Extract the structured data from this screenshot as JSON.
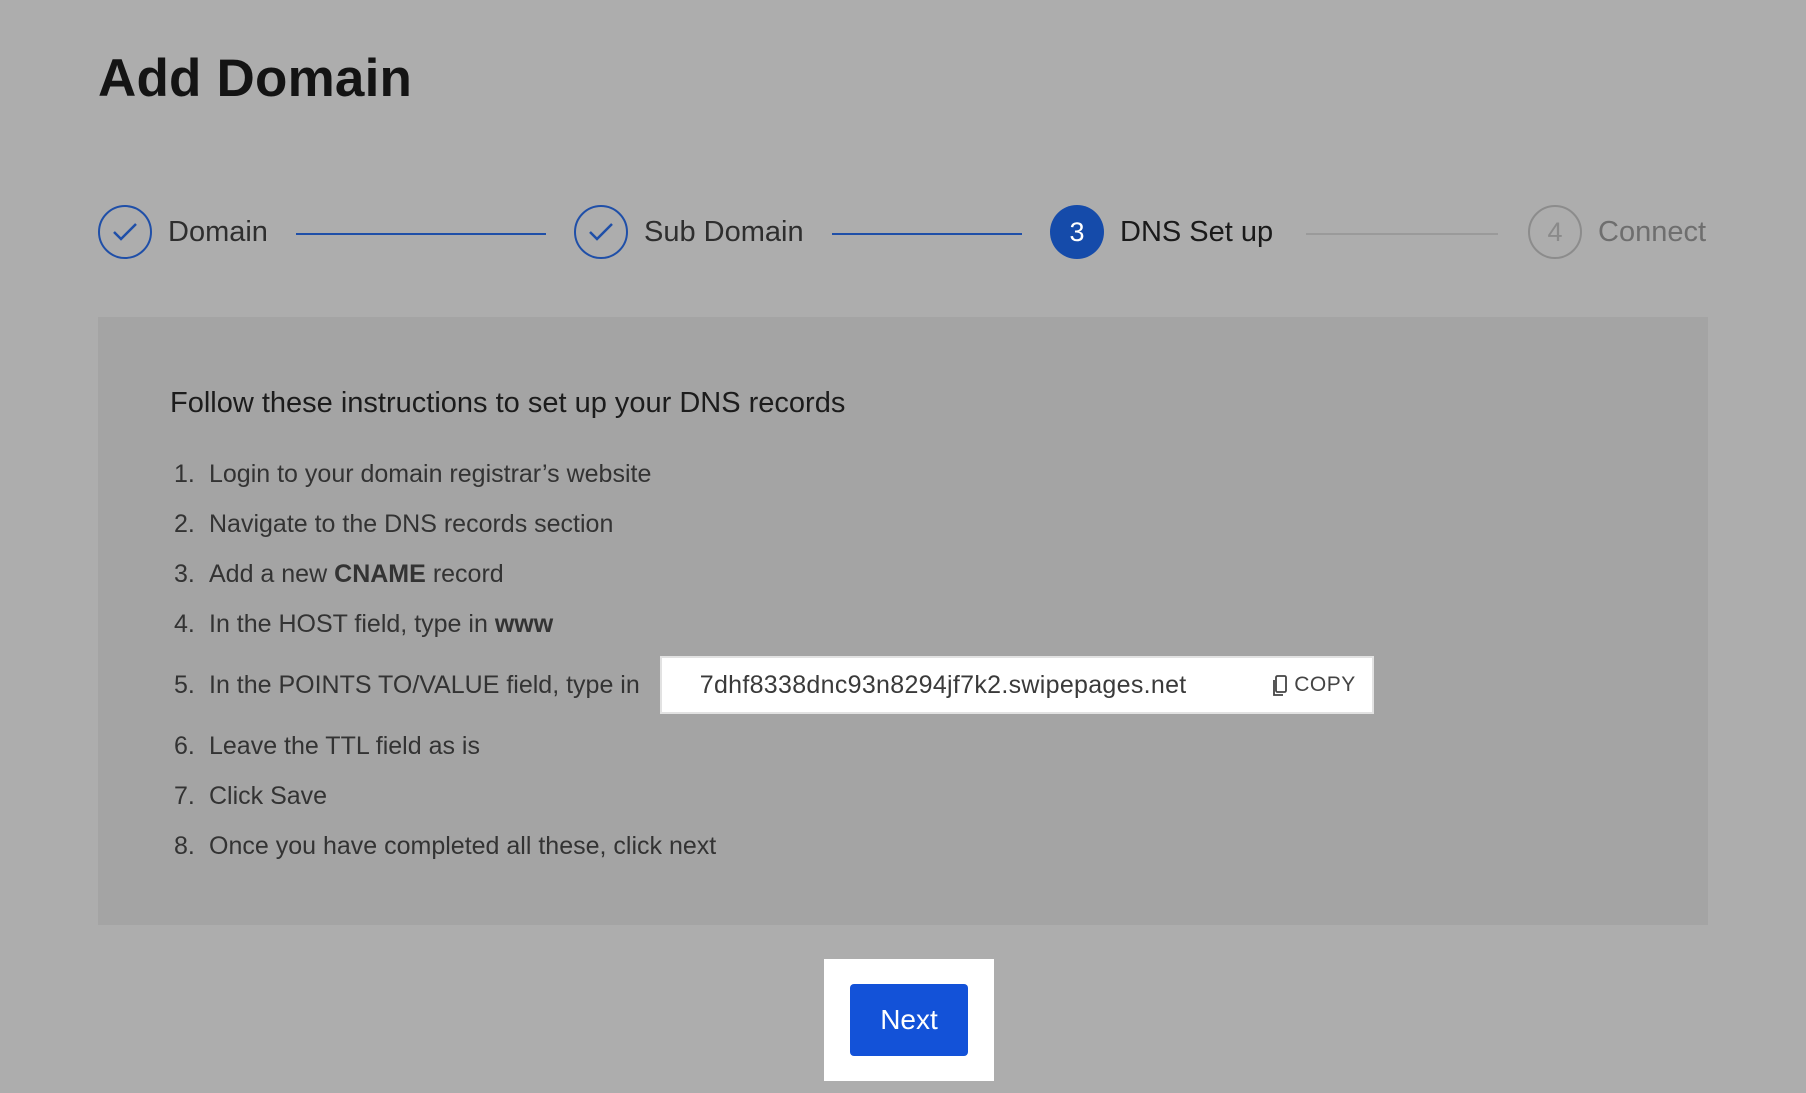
{
  "page": {
    "title": "Add Domain"
  },
  "stepper": {
    "steps": [
      {
        "label": "Domain",
        "status": "done",
        "marker": "check-icon"
      },
      {
        "label": "Sub Domain",
        "status": "done",
        "marker": "check-icon"
      },
      {
        "label": "DNS Set up",
        "status": "active",
        "number": "3"
      },
      {
        "label": "Connect",
        "status": "todo",
        "number": "4"
      }
    ]
  },
  "instructions": {
    "heading": "Follow these instructions to set up your DNS records",
    "items": [
      {
        "num": "1.",
        "text": "Login to your domain registrar’s website"
      },
      {
        "num": "2.",
        "text": "Navigate to the DNS records section"
      },
      {
        "num": "3.",
        "pre": "Add a new",
        "bold": "CNAME",
        "post": "record"
      },
      {
        "num": "4.",
        "pre": "In the HOST field, type in",
        "bold": "www"
      },
      {
        "num": "5.",
        "text": "In the POINTS TO/VALUE field, type in"
      },
      {
        "num": "6.",
        "text": "Leave the TTL field as is"
      },
      {
        "num": "7.",
        "text": "Click Save"
      },
      {
        "num": "8.",
        "text": "Once you have completed all these, click next"
      }
    ],
    "value": "7dhf8338dnc93n8294jf7k2.swipepages.net",
    "copy_label": "COPY"
  },
  "footer": {
    "next_label": "Next"
  },
  "colors": {
    "primary": "#154baa",
    "button": "#1352d8",
    "background": "#adadad",
    "panel": "#a4a4a4"
  }
}
